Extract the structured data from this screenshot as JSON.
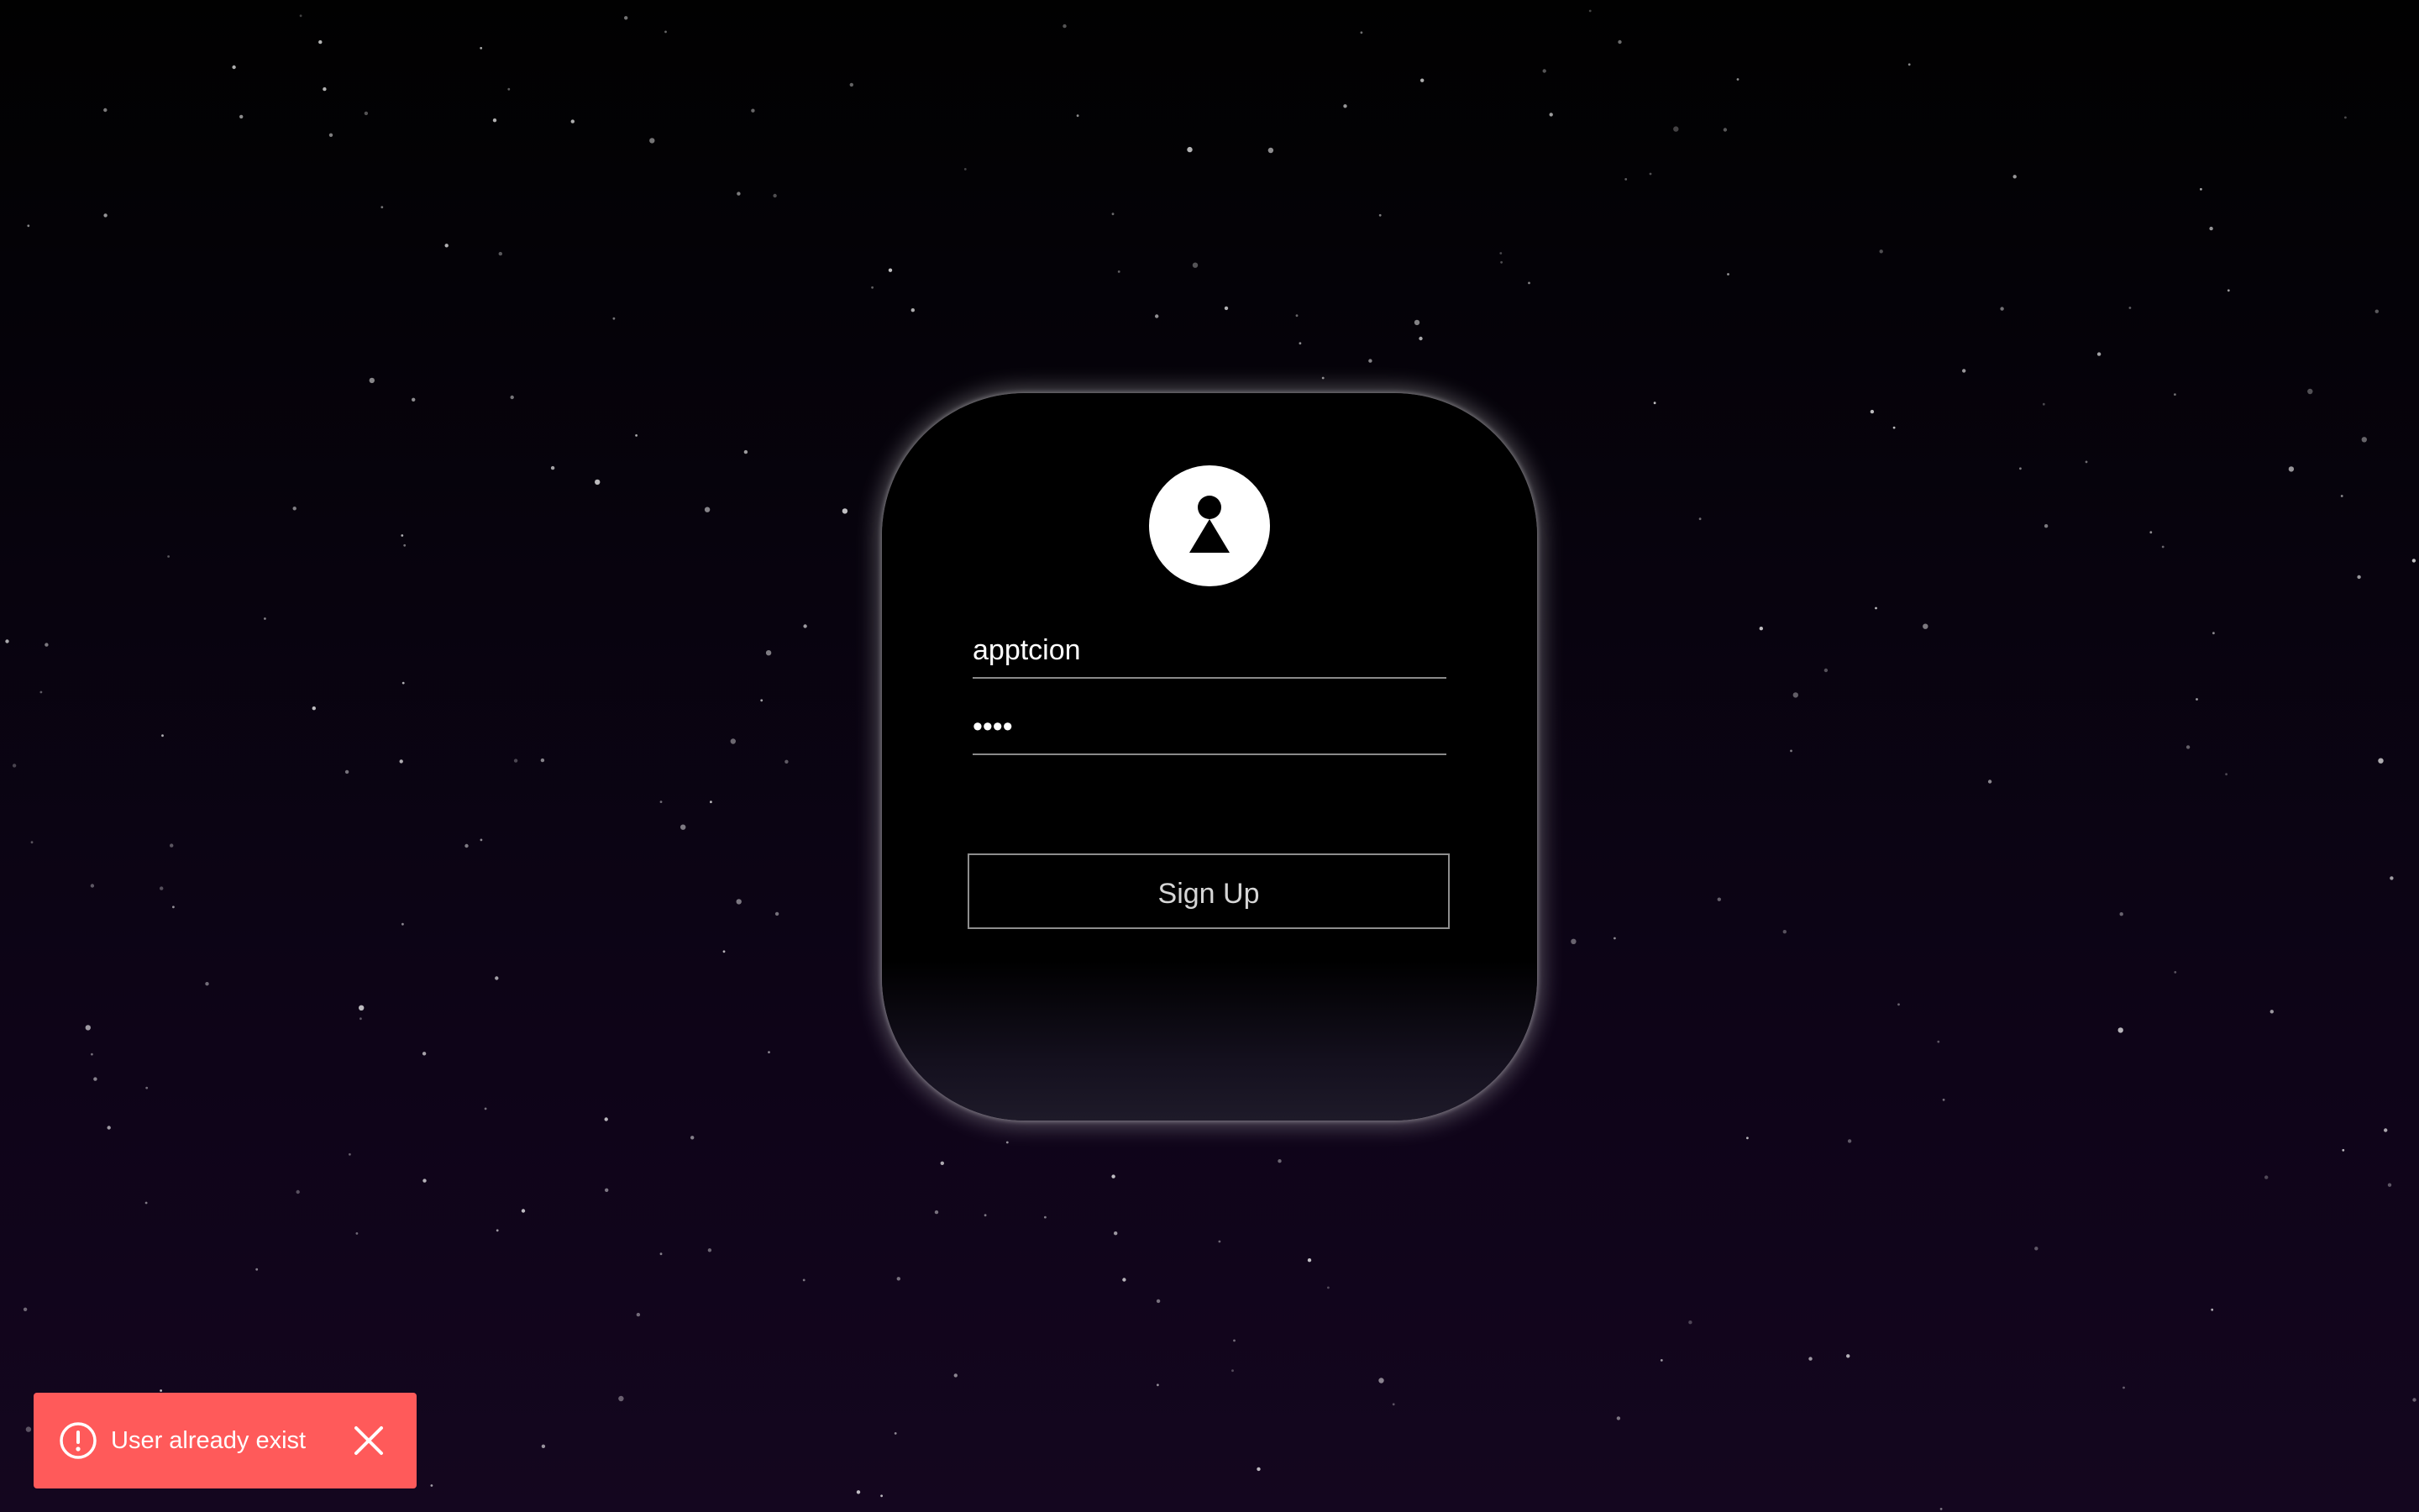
{
  "form": {
    "username_value": "apptcion",
    "password_value": "1234",
    "submit_label": "Sign Up",
    "avatar_icon": "user-avatar-icon"
  },
  "toast": {
    "message": "User already exist",
    "icon": "alert-circle-icon",
    "close_icon": "close-icon",
    "color": "#ff5a5a"
  },
  "theme": {
    "background_top": "#010101",
    "background_bottom": "#14061f",
    "card_background": "#000000",
    "text_color": "#ffffff"
  }
}
